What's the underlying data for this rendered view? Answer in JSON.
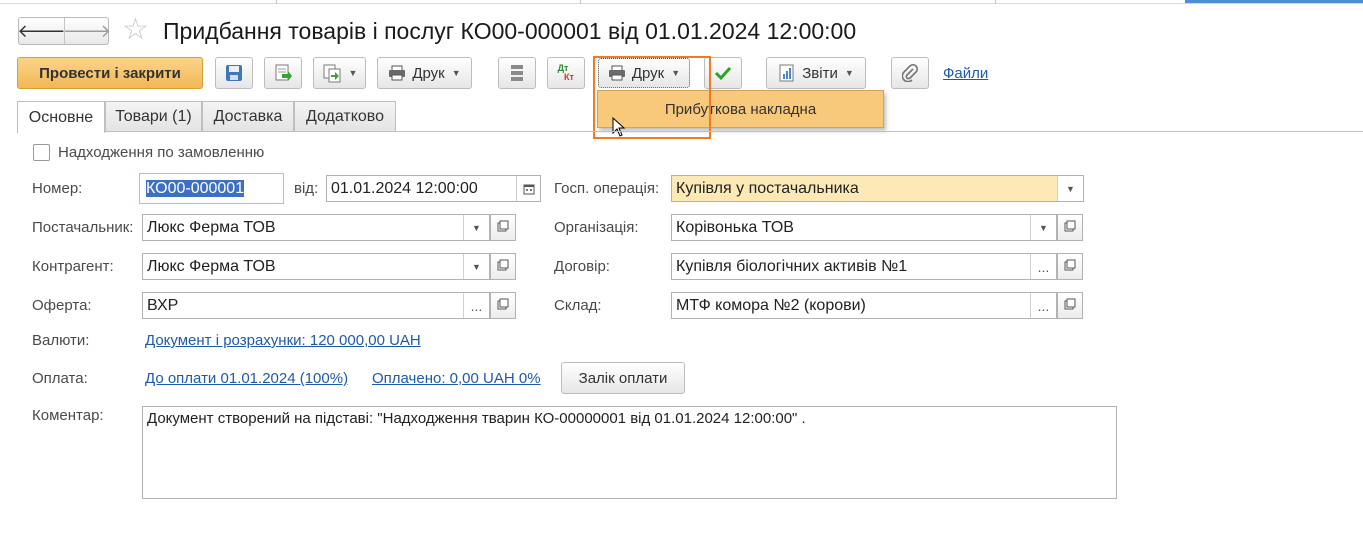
{
  "window": {
    "title": "Придбання товарів і послуг КО00-000001 від 01.01.2024 12:00:00",
    "back_glyph": "🡐",
    "forward_glyph": "🡒",
    "favorite_glyph": "☆"
  },
  "toolbar": {
    "post_close_label": "Провести і закрити",
    "print_label": "Друк",
    "print2_label": "Друк",
    "reports_label": "Звіти",
    "files_label": "Файли",
    "dtkt_top": "Дт",
    "dtkt_bottom": "Кт"
  },
  "print_menu": {
    "items": [
      "Прибуткова накладна"
    ]
  },
  "tabs": [
    {
      "label": "Основне",
      "active": true
    },
    {
      "label": "Товари (1)",
      "active": false
    },
    {
      "label": "Доставка",
      "active": false
    },
    {
      "label": "Додатково",
      "active": false
    }
  ],
  "form": {
    "by_order_label": "Надходження по замовленню",
    "by_order_checked": false,
    "number_label": "Номер:",
    "number_value": "КО00-000001",
    "date_label": "від:",
    "date_value": "01.01.2024 12:00:00",
    "operation_label": "Госп. операція:",
    "operation_value": "Купівля у постачальника",
    "supplier_label": "Постачальник:",
    "supplier_value": "Люкс Ферма ТОВ",
    "organization_label": "Організація:",
    "organization_value": "Корівонька ТОВ",
    "counterparty_label": "Контрагент:",
    "counterparty_value": "Люкс Ферма ТОВ",
    "contract_label": "Договір:",
    "contract_value": "Купівля біологічних активів №1",
    "offer_label": "Оферта:",
    "offer_value": "ВХР",
    "warehouse_label": "Склад:",
    "warehouse_value": "МТФ комора №2 (корови)",
    "currency_label": "Валюти:",
    "currency_link": "Документ і розрахунки: 120 000,00 UAH",
    "payment_label": "Оплата:",
    "payment_due_link": "До оплати 01.01.2024 (100%)",
    "payment_paid_link": "Оплачено: 0,00 UAH 0%",
    "offset_button": "Залік оплати",
    "comment_label": "Коментар:",
    "comment_value": "Документ створений на підставі: \"Надходження тварин КО-00000001 від 01.01.2024 12:00:00\" ."
  },
  "colors": {
    "accent_orange": "#f07c1f",
    "primary_button": "#f2b756",
    "highlight_field": "#fde9b6",
    "link": "#1f5aa8"
  }
}
